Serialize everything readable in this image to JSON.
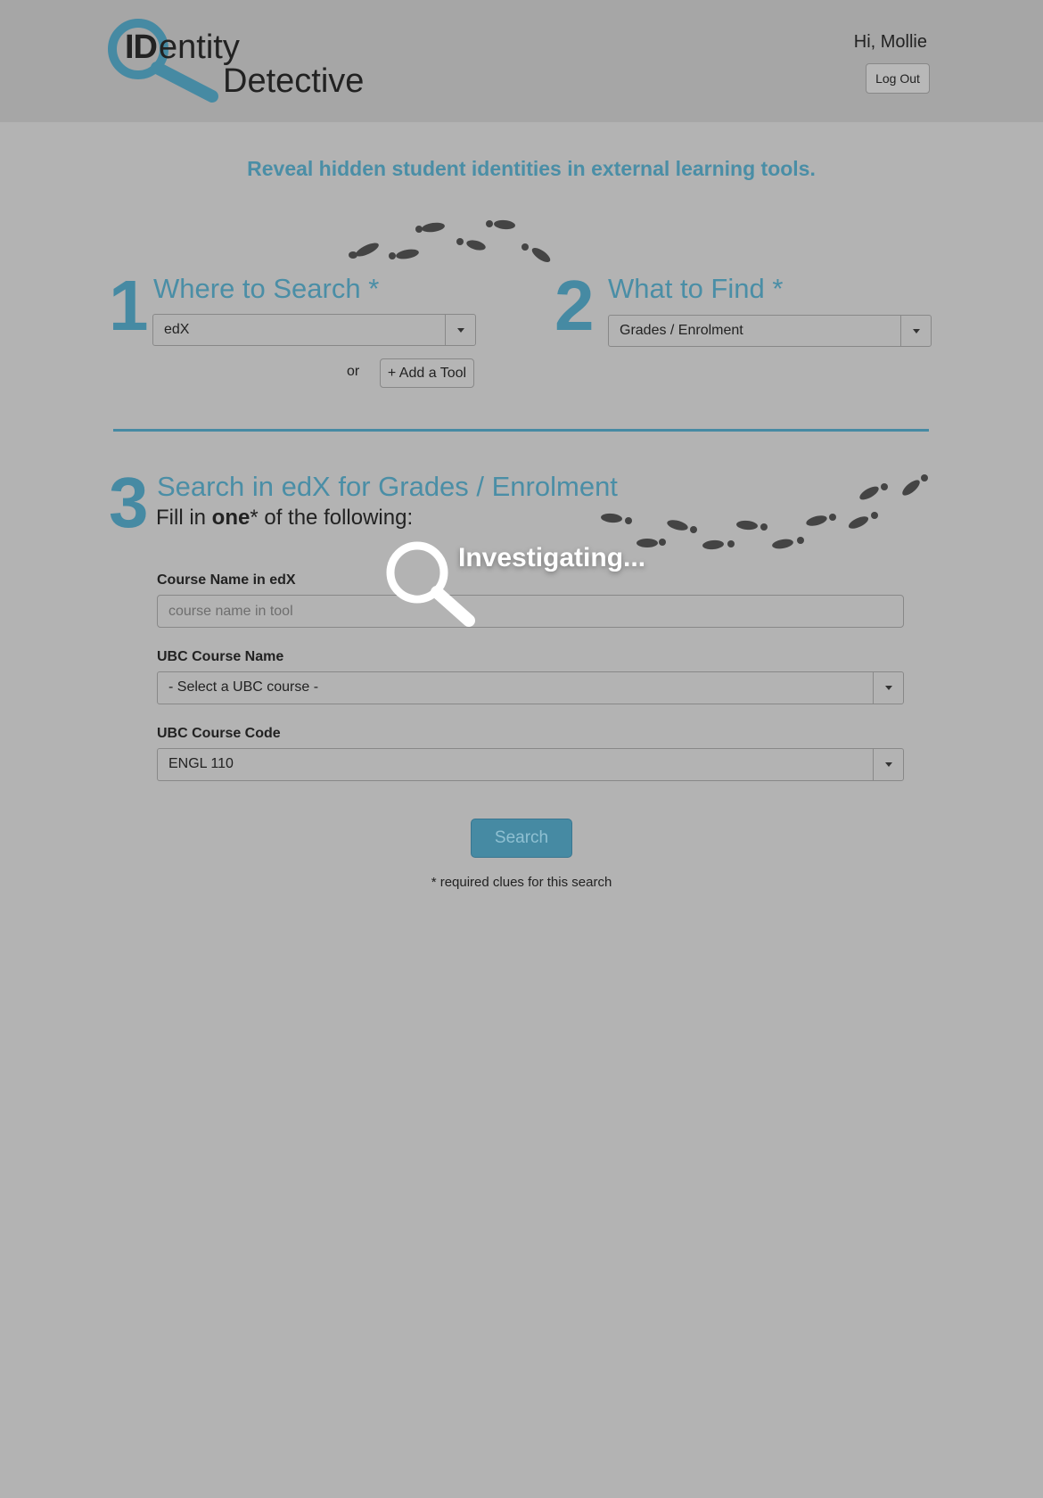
{
  "header": {
    "logo_id": "ID",
    "logo_entity": "entity",
    "logo_detective": "Detective",
    "greeting": "Hi, Mollie",
    "logout_label": "Log Out"
  },
  "tagline": "Reveal hidden student identities in external learning tools.",
  "step1": {
    "number": "1",
    "title": "Where to Search *",
    "selected": "edX",
    "or_label": "or",
    "add_tool_label": "+ Add a Tool"
  },
  "step2": {
    "number": "2",
    "title": "What to Find *",
    "selected": "Grades / Enrolment"
  },
  "step3": {
    "number": "3",
    "title": "Search in edX for Grades / Enrolment",
    "fill_prefix": "Fill in ",
    "fill_emphasis": "one",
    "fill_suffix": "* of the following:",
    "course_name_label": "Course Name in edX",
    "course_name_placeholder": "course name in tool",
    "course_name_value": "",
    "ubc_name_label": "UBC Course Name",
    "ubc_name_selected": "- Select a UBC course -",
    "ubc_code_label": "UBC Course Code",
    "ubc_code_selected": "ENGL 110",
    "search_label": "Search",
    "required_note": "* required clues for this search"
  },
  "overlay": {
    "text": "Investigating..."
  },
  "colors": {
    "accent": "#468aa3",
    "background": "#b3b3b3",
    "header_bg": "#a6a6a6"
  }
}
